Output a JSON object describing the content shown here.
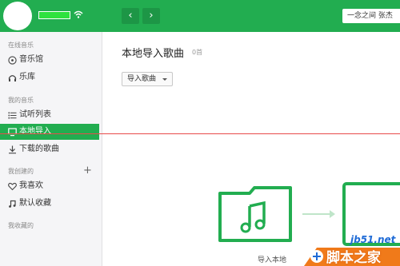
{
  "header": {
    "back_label": "‹",
    "forward_label": "›",
    "search_value": "一念之间 张杰"
  },
  "sidebar": {
    "online_title": "在线音乐",
    "online_items": [
      {
        "label": "音乐馆",
        "icon": "music-disc-icon"
      },
      {
        "label": "乐库",
        "icon": "headphones-icon"
      }
    ],
    "my_music_title": "我的音乐",
    "my_music_items": [
      {
        "label": "试听列表",
        "icon": "list-icon"
      },
      {
        "label": "本地导入",
        "icon": "monitor-icon",
        "active": true
      },
      {
        "label": "下载的歌曲",
        "icon": "download-icon"
      }
    ],
    "created_title": "我创建的",
    "created_items": [
      {
        "label": "我喜欢",
        "icon": "heart-icon"
      },
      {
        "label": "默认收藏",
        "icon": "note-icon"
      }
    ],
    "collected_title": "我收藏的"
  },
  "main": {
    "title": "本地导入歌曲",
    "count": "0首",
    "import_button": "导入歌曲",
    "caption": "导入本地"
  },
  "watermark": {
    "url": "jb51.net",
    "text": "脚本之家"
  },
  "colors": {
    "accent": "#22ad50",
    "sidebar_bg": "#f5f5f7",
    "guide_line": "#e84b4b"
  }
}
